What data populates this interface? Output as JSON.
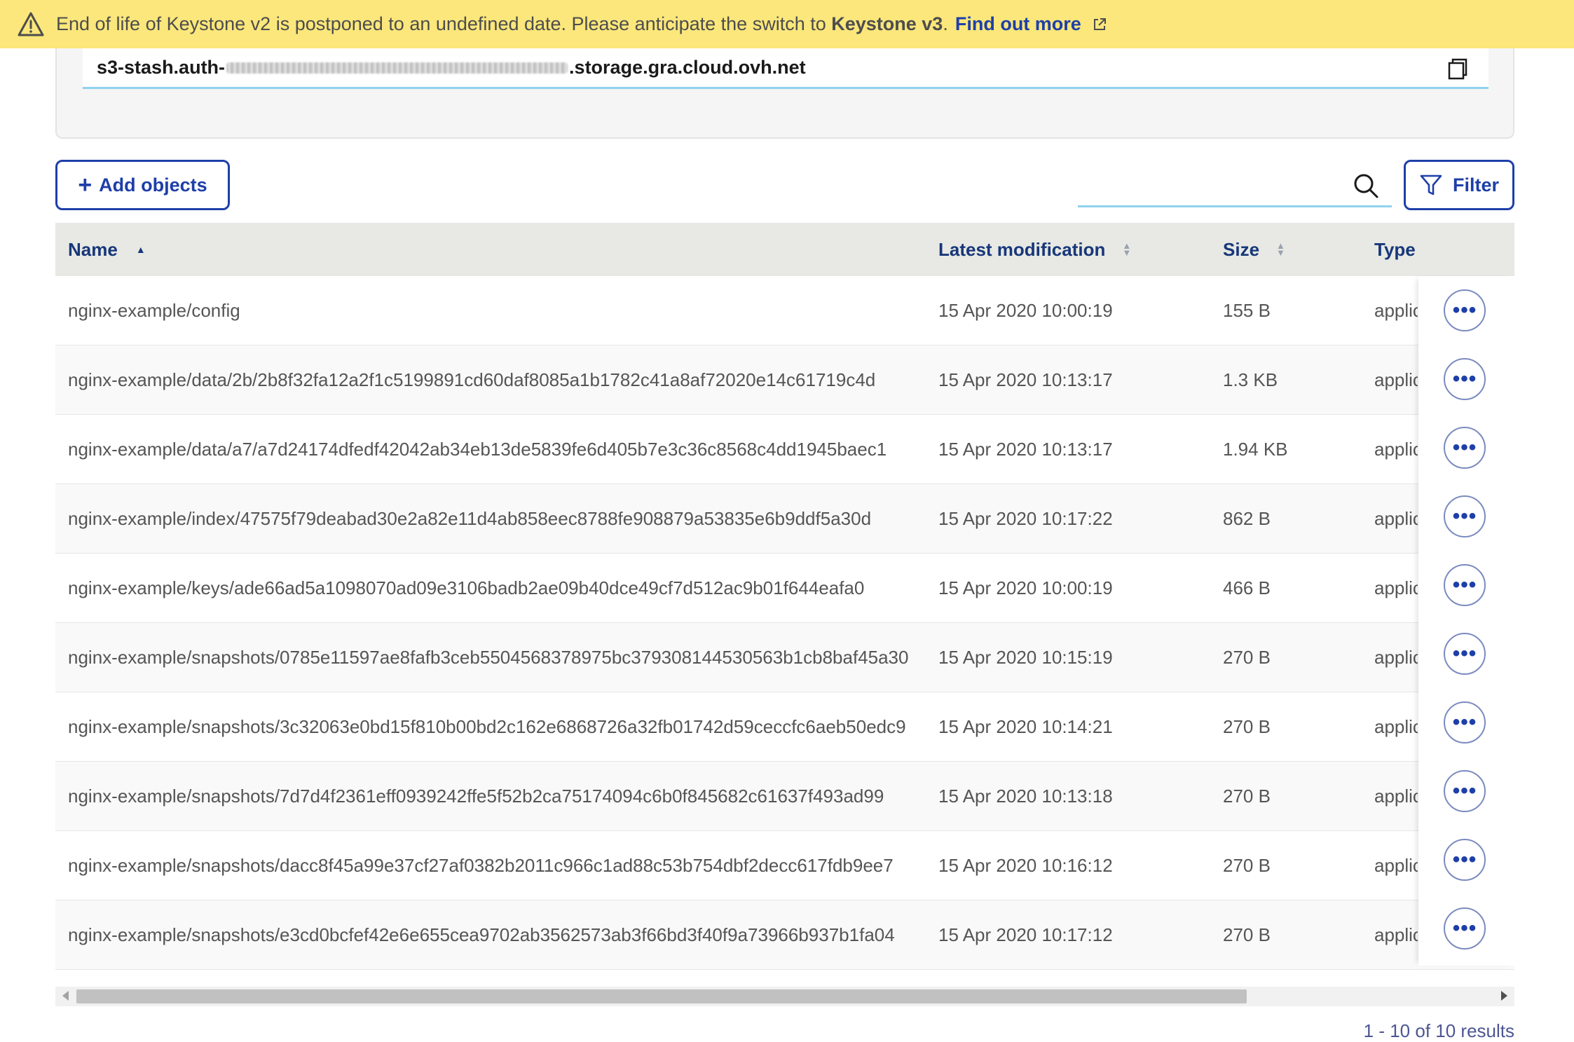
{
  "banner": {
    "text": "End of life of Keystone v2 is postponed to an undefined date. Please anticipate the switch to",
    "highlight": "Keystone v3",
    "period": ".",
    "link": "Find out more",
    "icon": "warning-icon",
    "link_icon": "external-link-icon",
    "bg_color": "#fbe77b"
  },
  "endpoint": {
    "prefix": "s3-stash.auth-",
    "suffix": ".storage.gra.cloud.ovh.net",
    "copy_icon": "copy-icon"
  },
  "toolbar": {
    "add_label": "Add objects",
    "add_icon": "+",
    "search_placeholder": "",
    "filter_label": "Filter",
    "accent_color": "#1e3fa8"
  },
  "table": {
    "columns": {
      "name": "Name",
      "modified": "Latest modification",
      "size": "Size",
      "type": "Type"
    },
    "rows": [
      {
        "name": "nginx-example/config",
        "modified": "15 Apr 2020 10:00:19",
        "size": "155 B",
        "type": "applic"
      },
      {
        "name": "nginx-example/data/2b/2b8f32fa12a2f1c5199891cd60daf8085a1b1782c41a8af72020e14c61719c4d",
        "modified": "15 Apr 2020 10:13:17",
        "size": "1.3 KB",
        "type": "applic"
      },
      {
        "name": "nginx-example/data/a7/a7d24174dfedf42042ab34eb13de5839fe6d405b7e3c36c8568c4dd1945baec1",
        "modified": "15 Apr 2020 10:13:17",
        "size": "1.94 KB",
        "type": "applic"
      },
      {
        "name": "nginx-example/index/47575f79deabad30e2a82e11d4ab858eec8788fe908879a53835e6b9ddf5a30d",
        "modified": "15 Apr 2020 10:17:22",
        "size": "862 B",
        "type": "applic"
      },
      {
        "name": "nginx-example/keys/ade66ad5a1098070ad09e3106badb2ae09b40dce49cf7d512ac9b01f644eafa0",
        "modified": "15 Apr 2020 10:00:19",
        "size": "466 B",
        "type": "applic"
      },
      {
        "name": "nginx-example/snapshots/0785e11597ae8fafb3ceb5504568378975bc379308144530563b1cb8baf45a30",
        "modified": "15 Apr 2020 10:15:19",
        "size": "270 B",
        "type": "applic"
      },
      {
        "name": "nginx-example/snapshots/3c32063e0bd15f810b00bd2c162e6868726a32fb01742d59ceccfc6aeb50edc9",
        "modified": "15 Apr 2020 10:14:21",
        "size": "270 B",
        "type": "applic"
      },
      {
        "name": "nginx-example/snapshots/7d7d4f2361eff0939242ffe5f52b2ca75174094c6b0f845682c61637f493ad99",
        "modified": "15 Apr 2020 10:13:18",
        "size": "270 B",
        "type": "applic"
      },
      {
        "name": "nginx-example/snapshots/dacc8f45a99e37cf27af0382b2011c966c1ad88c53b754dbf2decc617fdb9ee7",
        "modified": "15 Apr 2020 10:16:12",
        "size": "270 B",
        "type": "applic"
      },
      {
        "name": "nginx-example/snapshots/e3cd0bcfef42e6e655cea9702ab3562573ab3f66bd3f40f9a73966b937b1fa04",
        "modified": "15 Apr 2020 10:17:12",
        "size": "270 B",
        "type": "applic"
      }
    ],
    "action_label": "•••"
  },
  "pagination": {
    "results": "1 - 10 of 10 results"
  }
}
